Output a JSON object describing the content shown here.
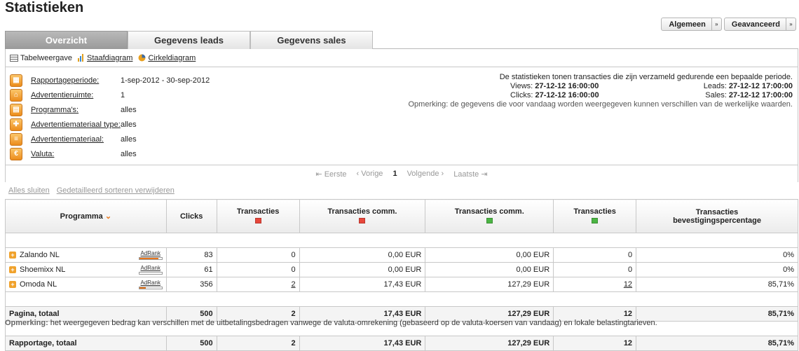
{
  "page": {
    "title": "Statistieken"
  },
  "top_buttons": [
    {
      "label": "Algemeen",
      "dropdown": "»"
    },
    {
      "label": "Geavanceerd",
      "dropdown": "»"
    }
  ],
  "tabs": [
    {
      "label": "Overzicht",
      "active": true
    },
    {
      "label": "Gegevens leads",
      "active": false
    },
    {
      "label": "Gegevens sales",
      "active": false
    }
  ],
  "view_options": [
    {
      "label": "Tabelweergave",
      "icon": "table-icon"
    },
    {
      "label": "Staafdiagram",
      "icon": "bar-chart-icon"
    },
    {
      "label": "Cirkeldiagram",
      "icon": "pie-chart-icon"
    }
  ],
  "filters": [
    {
      "label": "Rapportageperiode:",
      "value": "1-sep-2012 - 30-sep-2012",
      "icon": "calendar-icon"
    },
    {
      "label": "Advertentieruimte:",
      "value": "1",
      "icon": "house-icon"
    },
    {
      "label": "Programma's:",
      "value": "alles",
      "icon": "grid-icon"
    },
    {
      "label": "Advertentiemateriaal type:",
      "value": "alles",
      "icon": "puzzle-icon"
    },
    {
      "label": "Advertentiemateriaal:",
      "value": "alles",
      "icon": "document-icon"
    },
    {
      "label": "Valuta:",
      "value": "alles",
      "icon": "euro-icon"
    }
  ],
  "info": {
    "intro": "De statistieken tonen transacties die zijn verzameld gedurende een bepaalde periode.",
    "views_label": "Views:",
    "views_value": "27-12-12 16:00:00",
    "leads_label": "Leads:",
    "leads_value": "27-12-12 17:00:00",
    "clicks_label": "Clicks:",
    "clicks_value": "27-12-12 16:00:00",
    "sales_label": "Sales:",
    "sales_value": "27-12-12 17:00:00",
    "note": "Opmerking: de gegevens die voor vandaag worden weergegeven kunnen verschillen van de werkelijke waarden."
  },
  "pager": {
    "first": "Eerste",
    "prev": "Vorige",
    "current": "1",
    "next": "Volgende",
    "last": "Laatste"
  },
  "actions": {
    "close_all": "Alles sluiten",
    "remove_sort": "Gedetailleerd sorteren verwijderen"
  },
  "table": {
    "headers": {
      "programma": "Programma",
      "clicks": "Clicks",
      "transacties_open": "Transacties",
      "comm_open": "Transacties comm.",
      "comm_confirmed": "Transacties comm.",
      "transacties_confirmed": "Transacties",
      "bevestiging": "Transacties bevestigingspercentage"
    },
    "status_colors": {
      "open": "#e8473b",
      "confirmed": "#4bb544"
    },
    "adrank_label": "AdRank",
    "rows": [
      {
        "name": "Zalando NL",
        "adrank": 0.85,
        "clicks": "83",
        "trans_open": "0",
        "comm_open": "0,00 EUR",
        "comm_conf": "0,00 EUR",
        "trans_conf": "0",
        "pct": "0%"
      },
      {
        "name": "Shoemixx NL",
        "adrank": 0.0,
        "clicks": "61",
        "trans_open": "0",
        "comm_open": "0,00 EUR",
        "comm_conf": "0,00 EUR",
        "trans_conf": "0",
        "pct": "0%"
      },
      {
        "name": "Omoda NL",
        "adrank": 0.3,
        "clicks": "356",
        "trans_open": "2",
        "comm_open": "17,43 EUR",
        "comm_conf": "127,29 EUR",
        "trans_conf": "12",
        "pct": "85,71%"
      }
    ],
    "totals": [
      {
        "label": "Pagina, totaal",
        "clicks": "500",
        "trans_open": "2",
        "comm_open": "17,43 EUR",
        "comm_conf": "127,29 EUR",
        "trans_conf": "12",
        "pct": "85,71%"
      },
      {
        "label": "Rapportage, totaal",
        "clicks": "500",
        "trans_open": "2",
        "comm_open": "17,43 EUR",
        "comm_conf": "127,29 EUR",
        "trans_conf": "12",
        "pct": "85,71%"
      }
    ]
  },
  "footnote": {
    "label": "Opmerking:",
    "text": "het weergegeven bedrag kan verschillen met de uitbetalingsbedragen vanwege de valuta-omrekening (gebaseerd op de valuta-koersen van vandaag) en lokale belastingtarieven."
  }
}
